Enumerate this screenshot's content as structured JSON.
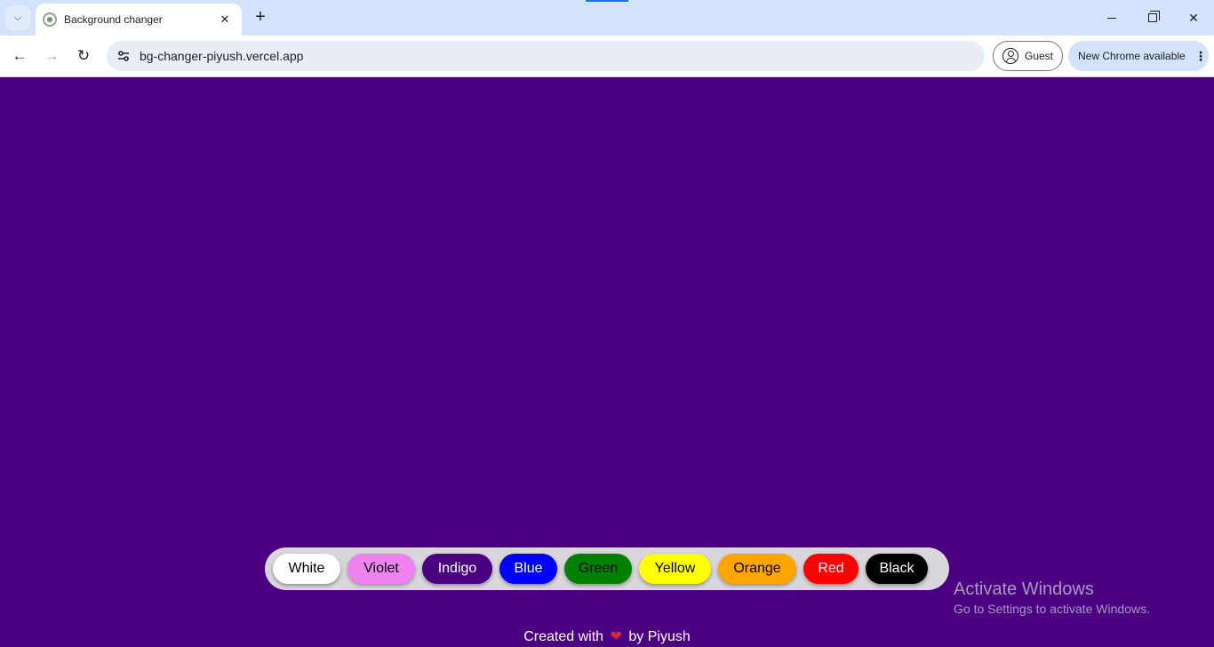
{
  "browser": {
    "tab_title": "Background changer",
    "url": "bg-changer-piyush.vercel.app",
    "profile_label": "Guest",
    "update_label": "New Chrome available"
  },
  "page": {
    "background_color": "#4b0082",
    "buttons": [
      {
        "label": "White",
        "bg": "#ffffff",
        "fg": "#000000"
      },
      {
        "label": "Violet",
        "bg": "#ee82ee",
        "fg": "#000000"
      },
      {
        "label": "Indigo",
        "bg": "#4b0082",
        "fg": "#ffffff"
      },
      {
        "label": "Blue",
        "bg": "#0000ff",
        "fg": "#ffffff"
      },
      {
        "label": "Green",
        "bg": "#008000",
        "fg": "#000000"
      },
      {
        "label": "Yellow",
        "bg": "#ffff00",
        "fg": "#000000"
      },
      {
        "label": "Orange",
        "bg": "#ffa500",
        "fg": "#000000"
      },
      {
        "label": "Red",
        "bg": "#ff0000",
        "fg": "#ffffff"
      },
      {
        "label": "Black",
        "bg": "#000000",
        "fg": "#ffffff"
      }
    ],
    "footer": {
      "prefix": "Created with",
      "icon": "heart-icon",
      "suffix": "by Piyush"
    }
  },
  "watermark": {
    "title": "Activate Windows",
    "subtitle": "Go to Settings to activate Windows."
  }
}
